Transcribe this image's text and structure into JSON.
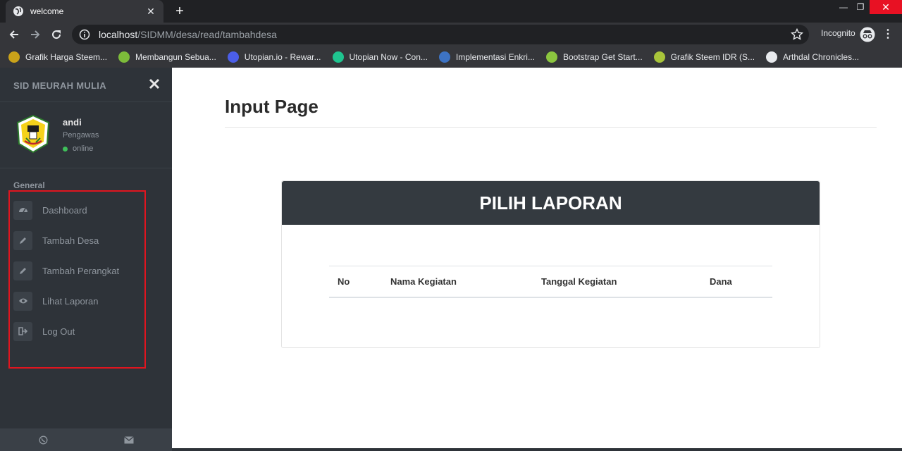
{
  "browser": {
    "tab_title": "welcome",
    "url_host": "localhost",
    "url_path": "/SIDMM/desa/read/tambahdesa",
    "incognito_label": "Incognito",
    "bookmarks": [
      {
        "label": "Grafik Harga Steem...",
        "color": "#c9a21a"
      },
      {
        "label": "Membangun Sebua...",
        "color": "#7dbb3a"
      },
      {
        "label": "Utopian.io - Rewar...",
        "color": "#4b5ee8"
      },
      {
        "label": "Utopian Now - Con...",
        "color": "#1fc48f"
      },
      {
        "label": "Implementasi Enkri...",
        "color": "#3d73c4"
      },
      {
        "label": "Bootstrap Get Start...",
        "color": "#8cc63f"
      },
      {
        "label": "Grafik Steem IDR (S...",
        "color": "#a8c43a"
      },
      {
        "label": "Arthdal Chronicles...",
        "color": "#e8eaed"
      }
    ]
  },
  "sidebar": {
    "brand": "SID MEURAH MULIA",
    "profile": {
      "name": "andi",
      "role": "Pengawas",
      "status": "online"
    },
    "section_title": "General",
    "items": [
      {
        "label": "Dashboard",
        "icon": "dashboard-icon"
      },
      {
        "label": "Tambah Desa",
        "icon": "pencil-icon"
      },
      {
        "label": "Tambah Perangkat",
        "icon": "pencil-icon"
      },
      {
        "label": "Lihat Laporan",
        "icon": "eye-icon"
      },
      {
        "label": "Log Out",
        "icon": "sign-out-icon"
      }
    ],
    "highlight_color": "#e0151f"
  },
  "main": {
    "page_title": "Input Page",
    "panel_title": "PILIH LAPORAN",
    "table": {
      "columns": [
        "No",
        "Nama Kegiatan",
        "Tanggal Kegiatan",
        "Dana"
      ],
      "rows": []
    }
  },
  "colors": {
    "sidebar_bg": "#2e3339",
    "panel_header_bg": "#343a40",
    "chrome_bg": "#35363a"
  }
}
